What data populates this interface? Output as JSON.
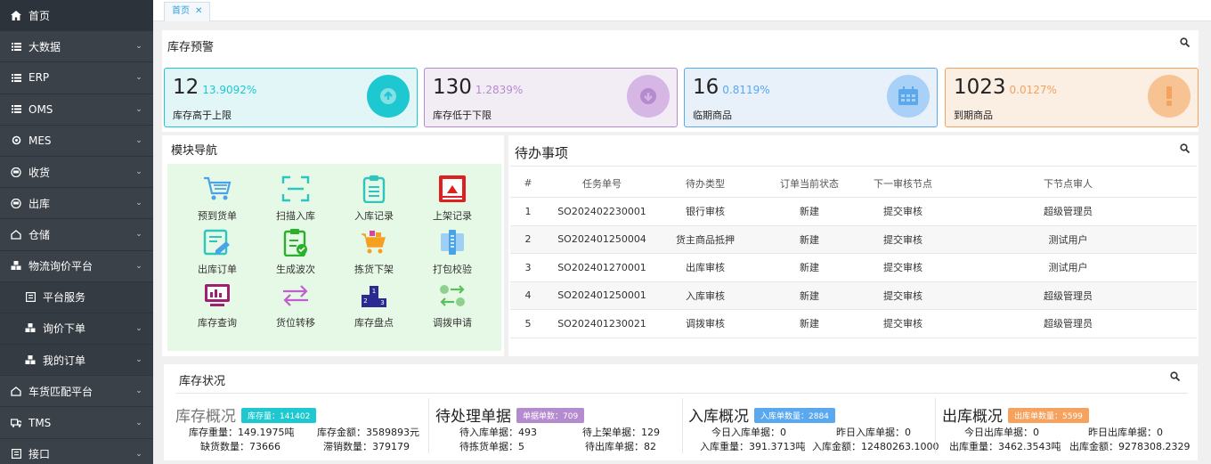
{
  "sidebar": {
    "items": [
      {
        "label": "首页",
        "icon": "home-icon",
        "arrow": false
      },
      {
        "label": "大数据",
        "icon": "list-icon",
        "arrow": true
      },
      {
        "label": "ERP",
        "icon": "list-icon",
        "arrow": true
      },
      {
        "label": "OMS",
        "icon": "list-icon",
        "arrow": true
      },
      {
        "label": "MES",
        "icon": "gear-icon",
        "arrow": true
      },
      {
        "label": "收货",
        "icon": "truck-icon",
        "arrow": true
      },
      {
        "label": "出库",
        "icon": "truck-icon",
        "arrow": true
      },
      {
        "label": "仓储",
        "icon": "house-icon",
        "arrow": true
      },
      {
        "label": "物流询价平台",
        "icon": "cubes-icon",
        "arrow": true
      },
      {
        "label": "平台服务",
        "icon": "doc-icon",
        "arrow": false
      },
      {
        "label": "询价下单",
        "icon": "cubes-icon",
        "arrow": true
      },
      {
        "label": "我的订单",
        "icon": "cubes-icon",
        "arrow": true
      },
      {
        "label": "车货匹配平台",
        "icon": "house-icon",
        "arrow": true
      },
      {
        "label": "TMS",
        "icon": "truck-icon",
        "arrow": true
      },
      {
        "label": "接口",
        "icon": "doc-icon",
        "arrow": true
      }
    ]
  },
  "tabs": {
    "home": "首页"
  },
  "alert": {
    "title": "库存预警",
    "cards": [
      {
        "num": "12",
        "pct": "13.9092%",
        "label": "库存高于上限"
      },
      {
        "num": "130",
        "pct": "1.2839%",
        "label": "库存低于下限"
      },
      {
        "num": "16",
        "pct": "0.8119%",
        "label": "临期商品"
      },
      {
        "num": "1023",
        "pct": "0.0127%",
        "label": "到期商品"
      }
    ]
  },
  "modules": {
    "title": "模块导航",
    "items": [
      "预到货单",
      "扫描入库",
      "入库记录",
      "上架记录",
      "出库订单",
      "生成波次",
      "拣货下架",
      "打包校验",
      "库存查询",
      "货位转移",
      "库存盘点",
      "调拨申请"
    ]
  },
  "todo": {
    "title": "待办事项",
    "headers": [
      "#",
      "任务单号",
      "待办类型",
      "订单当前状态",
      "下一审核节点",
      "下节点审人"
    ],
    "rows": [
      [
        "1",
        "SO202402230001",
        "银行审核",
        "新建",
        "提交审核",
        "超级管理员"
      ],
      [
        "2",
        "SO202401250004",
        "货主商品抵押",
        "新建",
        "提交审核",
        "测试用户"
      ],
      [
        "3",
        "SO202401270001",
        "出库审核",
        "新建",
        "提交审核",
        "测试用户"
      ],
      [
        "4",
        "SO202401250001",
        "入库审核",
        "新建",
        "提交审核",
        "超级管理员"
      ],
      [
        "5",
        "SO202401230021",
        "调拨审核",
        "新建",
        "提交审核",
        "超级管理员"
      ]
    ]
  },
  "stock": {
    "title": "库存状况",
    "inv": {
      "title": "库存概况",
      "badge": "库存量：141402",
      "l1": "库存重量：149.1975吨",
      "r1": "库存金额：3589893元",
      "l2": "缺货数量：73666",
      "r2": "滞销数量：379179"
    },
    "pend": {
      "title": "待处理单据",
      "badge": "单据单数：709",
      "l1": "待入库单据：493",
      "r1": "待上架单据：129",
      "l2": "待拣货单据：5",
      "r2": "待出库单据：82"
    },
    "inb": {
      "title": "入库概况",
      "badge": "入库单数量：2884",
      "l1": "今日入库单据：0",
      "r1": "昨日入库单据：0",
      "l2": "入库重量：391.3713吨",
      "r2": "入库金额：12480263.1000"
    },
    "outb": {
      "title": "出库概况",
      "badge": "出库单数量：5599",
      "l1": "今日出库单据：0",
      "r1": "昨日出库单据：0",
      "l2": "出库重量：3462.3543吨",
      "r2": "出库金额：9278308.2329"
    }
  },
  "colors": {
    "cyan": "#1ec8d0",
    "purple": "#b58bd0",
    "blue": "#5aa9ef",
    "orange": "#f5a25e"
  }
}
